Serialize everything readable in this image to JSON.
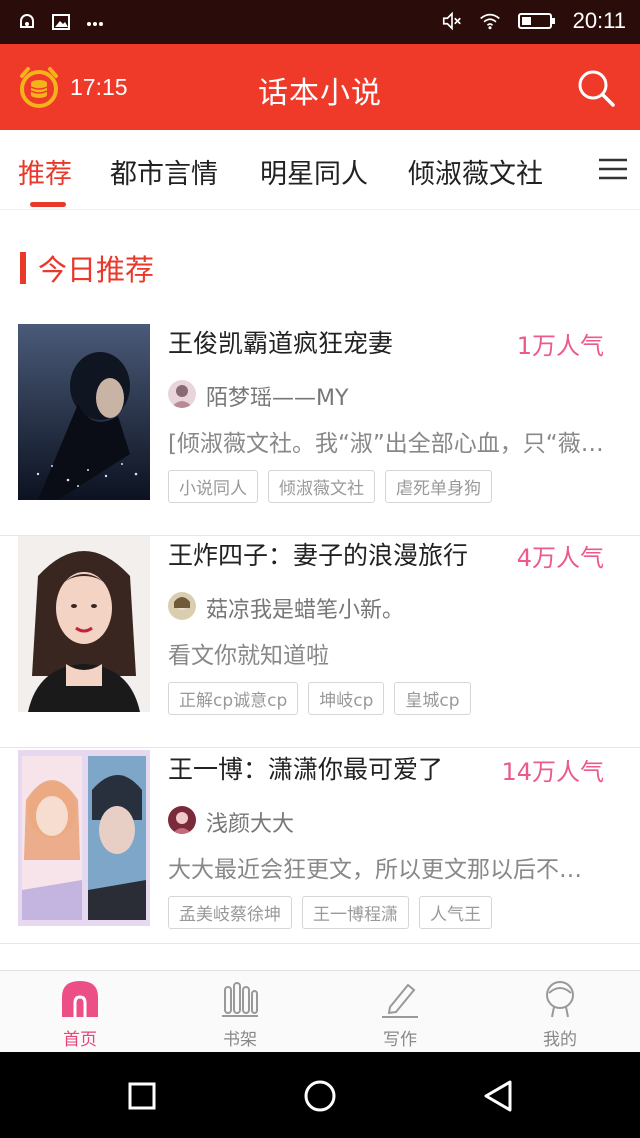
{
  "status_bar": {
    "time": "20:11",
    "left_icons": [
      "notification-icon",
      "image-icon",
      "more-dots-icon"
    ],
    "right_icons": [
      "mute-icon",
      "wifi-icon",
      "battery-icon"
    ]
  },
  "app_bar": {
    "alarm_time": "17:15",
    "title": "话本小说"
  },
  "tabs": [
    {
      "label": "推荐",
      "active": true
    },
    {
      "label": "都市言情",
      "active": false
    },
    {
      "label": "明星同人",
      "active": false
    },
    {
      "label": "倾淑薇文社",
      "active": false
    }
  ],
  "section": {
    "title": "今日推荐"
  },
  "books": [
    {
      "title": "王俊凯霸道疯狂宠妻",
      "popularity": "1万人气",
      "author": "陌梦瑶——MY",
      "description": "[倾淑薇文社。我“淑”出全部心血，只“薇…",
      "tags": [
        "小说同人",
        "倾淑薇文社",
        "虐死单身狗"
      ]
    },
    {
      "title": "王炸四子：妻子的浪漫旅行",
      "popularity": "4万人气",
      "author": "菇凉我是蜡笔小新。",
      "description": "看文你就知道啦",
      "tags": [
        "正解cp诚意cp",
        "坤岐cp",
        "皇城cp"
      ]
    },
    {
      "title": "王一博：潇潇你最可爱了",
      "popularity": "14万人气",
      "author": "浅颜大大",
      "description": "大大最近会狂更文，所以更文那以后不…",
      "tags": [
        "孟美岐蔡徐坤",
        "王一博程潇",
        "人气王"
      ]
    }
  ],
  "bottom_nav": [
    {
      "label": "首页",
      "icon": "home-icon",
      "active": true
    },
    {
      "label": "书架",
      "icon": "bookshelf-icon",
      "active": false
    },
    {
      "label": "写作",
      "icon": "pen-icon",
      "active": false
    },
    {
      "label": "我的",
      "icon": "profile-icon",
      "active": false
    }
  ],
  "colors": {
    "accent": "#ef3a2a",
    "status_bar": "#2a0d0b",
    "popularity": "#ec5a8c",
    "nav_active": "#e84477",
    "alarm_gold": "#f6b21b"
  }
}
